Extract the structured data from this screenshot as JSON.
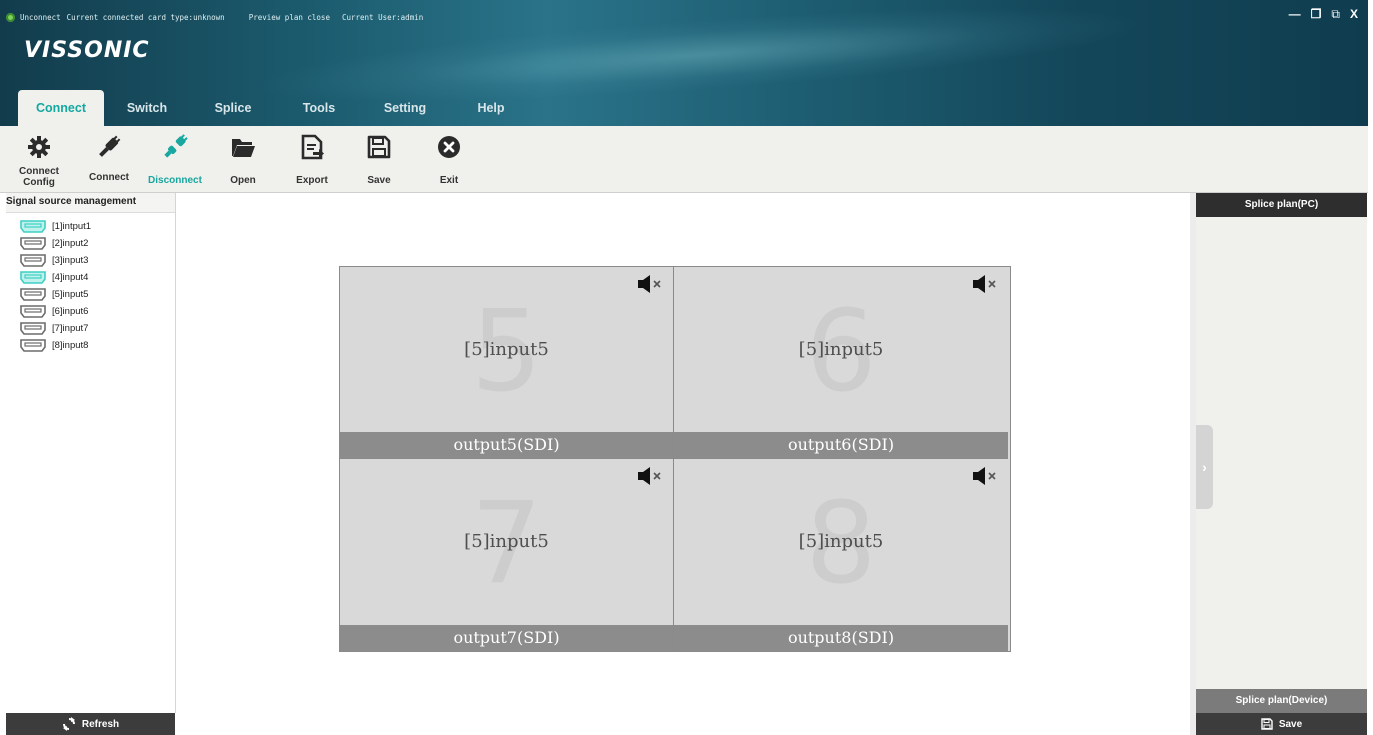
{
  "status": {
    "connection": "Unconnect",
    "card_type": "Current connected card type:unknown",
    "preview": "Preview plan close",
    "user": "Current User:admin"
  },
  "window_controls": {
    "minimize": "—",
    "restore": "❐",
    "popout": "⧉",
    "close": "X"
  },
  "brand": {
    "logo": "VISSONIC"
  },
  "tabs": [
    {
      "label": "Connect",
      "active": true
    },
    {
      "label": "Switch"
    },
    {
      "label": "Splice"
    },
    {
      "label": "Tools"
    },
    {
      "label": "Setting"
    },
    {
      "label": "Help"
    }
  ],
  "toolbar": [
    {
      "label": "Connect Config",
      "icon": "gear-icon"
    },
    {
      "label": "Connect",
      "icon": "plug-icon"
    },
    {
      "label": "Disconnect",
      "icon": "unplug-icon"
    },
    {
      "label": "Open",
      "icon": "folder-open-icon"
    },
    {
      "label": "Export",
      "icon": "export-icon"
    },
    {
      "label": "Save",
      "icon": "floppy-icon"
    },
    {
      "label": "Exit",
      "icon": "exit-icon"
    }
  ],
  "signal_sources": {
    "title": "Signal source management",
    "items": [
      {
        "label": "[1]intput1",
        "active": true
      },
      {
        "label": "[2]input2",
        "active": false
      },
      {
        "label": "[3]input3",
        "active": false
      },
      {
        "label": "[4]input4",
        "active": true
      },
      {
        "label": "[5]input5",
        "active": false
      },
      {
        "label": "[6]input6",
        "active": false
      },
      {
        "label": "[7]input7",
        "active": false
      },
      {
        "label": "[8]input8",
        "active": false
      }
    ],
    "refresh_label": "Refresh"
  },
  "outputs": [
    {
      "number": "5",
      "input": "[5]input5",
      "output": "output5(SDI)",
      "muted": true
    },
    {
      "number": "6",
      "input": "[5]input5",
      "output": "output6(SDI)",
      "muted": true
    },
    {
      "number": "7",
      "input": "[5]input5",
      "output": "output7(SDI)",
      "muted": true
    },
    {
      "number": "8",
      "input": "[5]input5",
      "output": "output8(SDI)",
      "muted": true
    }
  ],
  "splice_panel": {
    "pc_title": "Splice plan(PC)",
    "device_title": "Splice plan(Device)",
    "save_label": "Save",
    "expand_glyph": "›"
  },
  "colors": {
    "accent": "#19a7a0",
    "header_dark": "#123c4c",
    "port_active": "#3fd0c4",
    "port_inactive": "#6c6c6c"
  }
}
